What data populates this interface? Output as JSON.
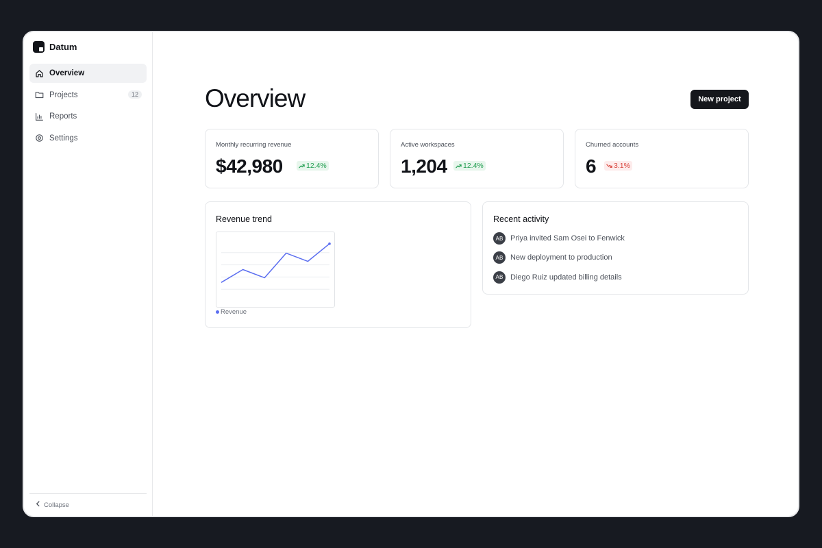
{
  "app": {
    "name": "Datum"
  },
  "sidebar": {
    "items": [
      {
        "label": "Overview",
        "icon": "home-icon",
        "active": true
      },
      {
        "label": "Projects",
        "icon": "folder-icon",
        "badge": "12"
      },
      {
        "label": "Reports",
        "icon": "bar-chart-icon"
      },
      {
        "label": "Settings",
        "icon": "gear-icon"
      }
    ],
    "collapse_label": "Collapse"
  },
  "header": {
    "title": "Overview",
    "new_project_label": "New project"
  },
  "stats": [
    {
      "label": "Monthly recurring revenue",
      "value": "$42,980",
      "delta": "12.4%",
      "trend": "up"
    },
    {
      "label": "Active workspaces",
      "value": "1,204",
      "delta": "12.4%",
      "trend": "up"
    },
    {
      "label": "Churned accounts",
      "value": "6",
      "delta": "3.1%",
      "trend": "down"
    }
  ],
  "revenue_trend": {
    "title": "Revenue trend",
    "legend": "Revenue"
  },
  "recent_activity": {
    "title": "Recent activity",
    "items": [
      {
        "avatar": "AB",
        "text": "Priya invited Sam Osei to Fenwick"
      },
      {
        "avatar": "AB",
        "text": "New deployment to production"
      },
      {
        "avatar": "AB",
        "text": "Diego Ruiz updated billing details"
      }
    ]
  },
  "colors": {
    "accent": "#5b6ef0",
    "positive": "#1f9d4f",
    "negative": "#d9453d",
    "primary_button": "#15171c"
  },
  "chart_data": {
    "type": "line",
    "x": [
      1,
      2,
      3,
      4,
      5,
      6
    ],
    "series": [
      {
        "name": "Revenue",
        "values": [
          15,
          26,
          19,
          40,
          33,
          48
        ]
      }
    ],
    "ylim": [
      0,
      52
    ],
    "grid": true,
    "legend": "bottom-left"
  }
}
